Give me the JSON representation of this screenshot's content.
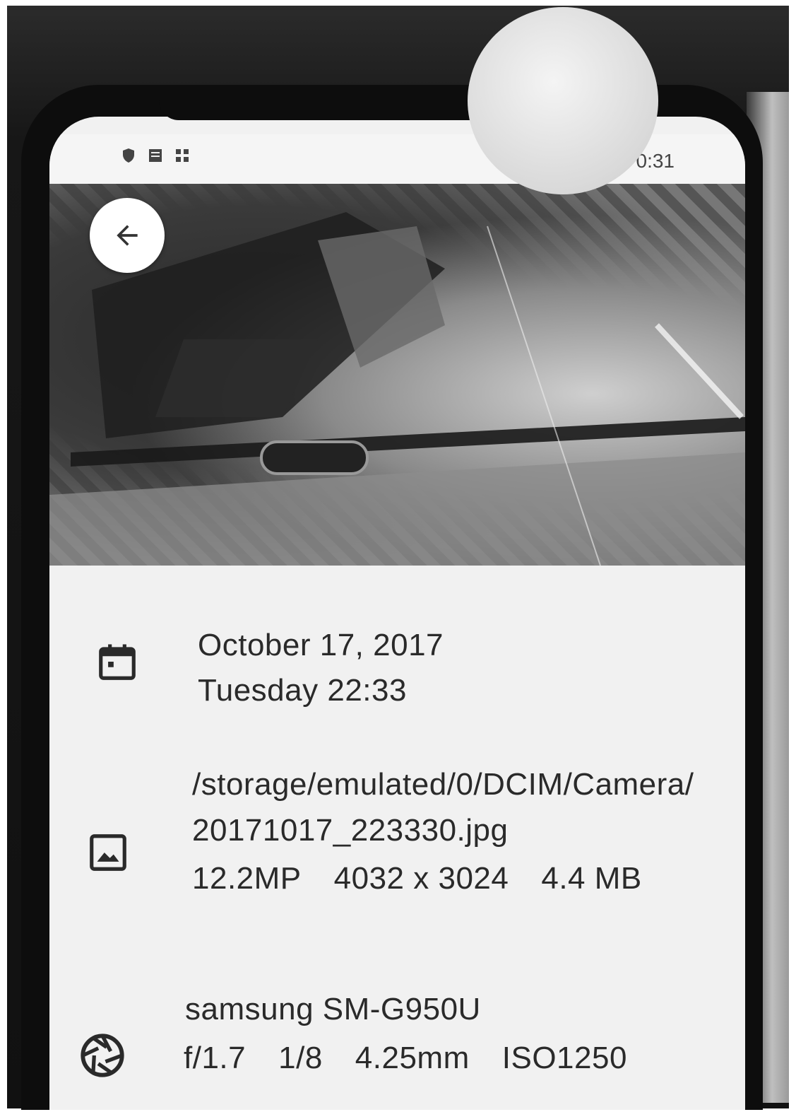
{
  "status_bar": {
    "time": "0:31",
    "icons": [
      "shield-icon",
      "notification-icon",
      "grid-icon"
    ]
  },
  "toolbar": {
    "back_icon": "arrow-left-icon"
  },
  "details": {
    "date": {
      "icon": "calendar-icon",
      "date_line": "October 17, 2017",
      "day_time_line": "Tuesday 22:33"
    },
    "file": {
      "icon": "image-icon",
      "path_line1": "/storage/emulated/0/DCIM/Camera/",
      "path_line2": "20171017_223330.jpg",
      "megapixels": "12.2MP",
      "resolution": "4032 x 3024",
      "size": "4.4 MB"
    },
    "camera": {
      "icon": "aperture-icon",
      "model": "samsung SM-G950U",
      "aperture": "f/1.7",
      "shutter": "1/8",
      "focal_length": "4.25mm",
      "iso": "ISO1250"
    }
  }
}
